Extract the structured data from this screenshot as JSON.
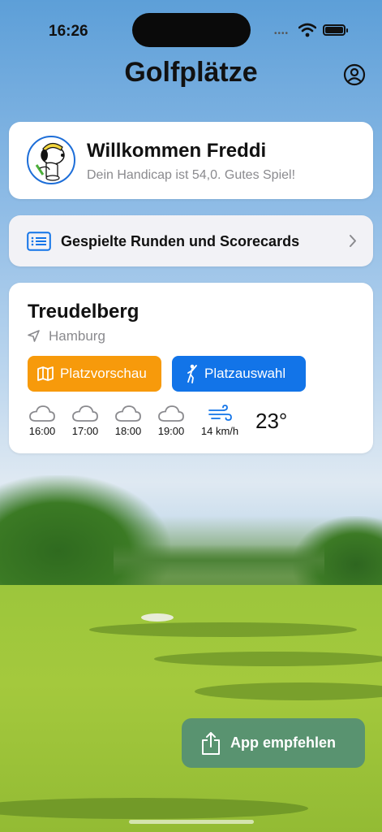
{
  "status_bar": {
    "time": "16:26"
  },
  "header": {
    "title": "Golfplätze",
    "profile_icon": "person-circle-icon"
  },
  "welcome": {
    "title": "Willkommen Freddi",
    "subtitle": "Dein Handicap ist 54,0. Gutes Spiel!"
  },
  "rounds": {
    "label": "Gespielte Runden und Scorecards",
    "icon": "list-icon"
  },
  "course": {
    "name": "Treudelberg",
    "location": "Hamburg",
    "preview_button": "Platzvorschau",
    "select_button": "Platzauswahl",
    "forecast": [
      {
        "time": "16:00",
        "icon": "cloud-icon"
      },
      {
        "time": "17:00",
        "icon": "cloud-icon"
      },
      {
        "time": "18:00",
        "icon": "cloud-icon"
      },
      {
        "time": "19:00",
        "icon": "cloud-icon"
      }
    ],
    "wind": "14 km/h",
    "temperature": "23°"
  },
  "recommend": {
    "label": "App empfehlen",
    "icon": "share-icon"
  },
  "colors": {
    "orange": "#f79a0b",
    "blue": "#1274e8",
    "recommend_bg": "#508c78"
  }
}
